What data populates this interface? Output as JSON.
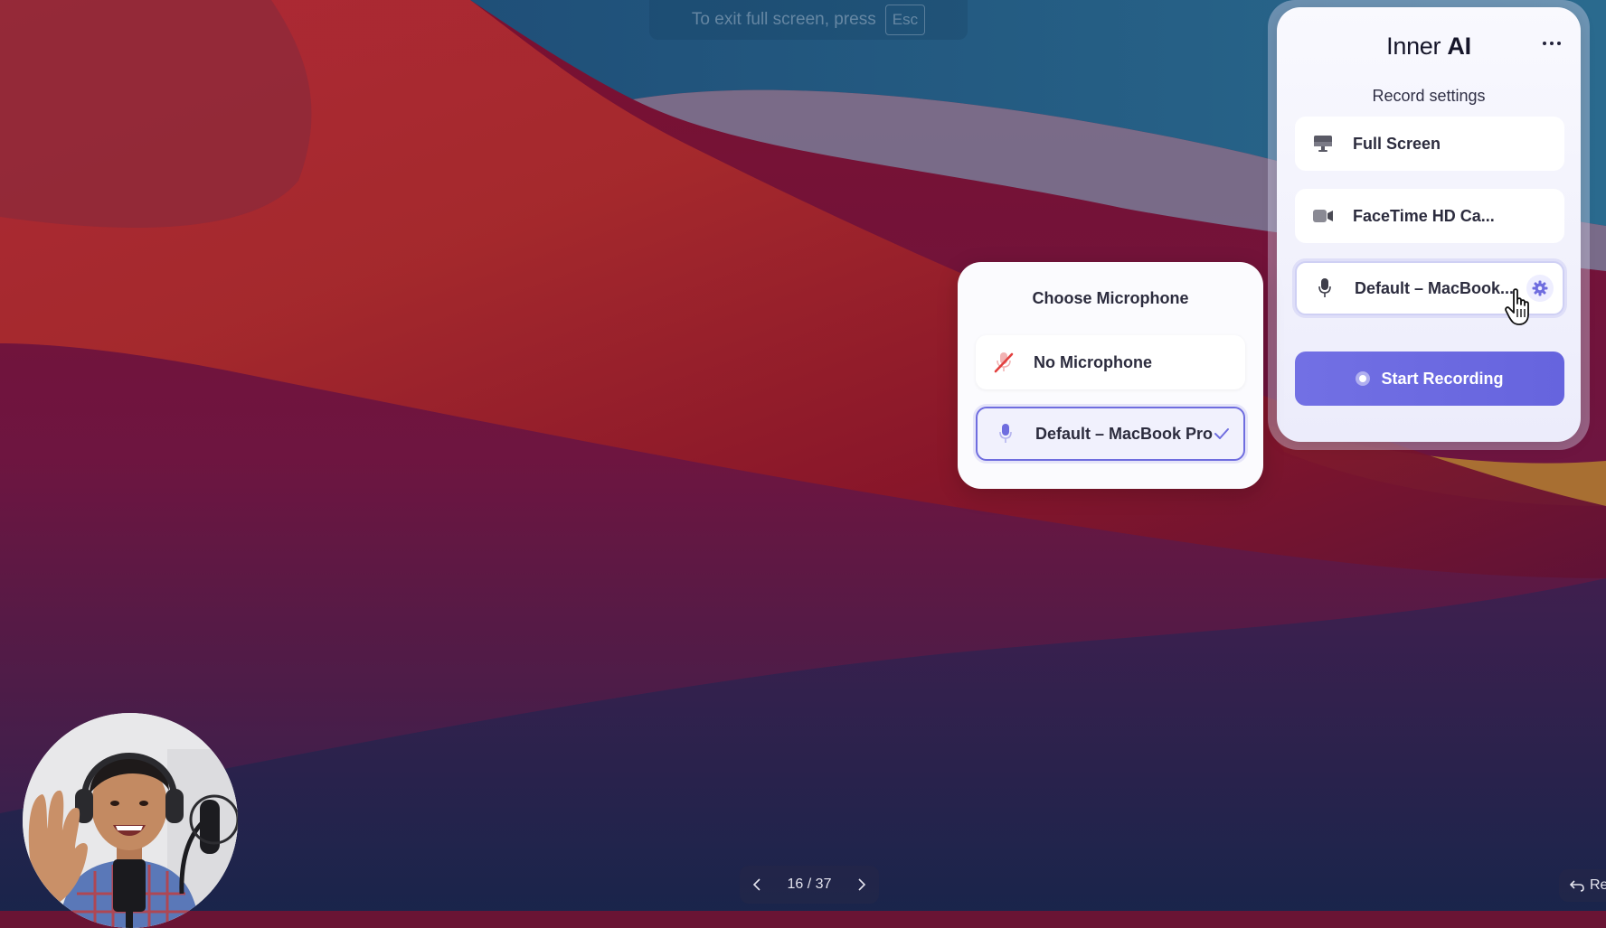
{
  "fullscreen_notice": {
    "text": "To exit full screen, press",
    "key": "Esc"
  },
  "panel": {
    "brand_light": "Inner ",
    "brand_bold": "AI",
    "more_icon": "ellipsis-icon",
    "subtitle": "Record settings",
    "options": [
      {
        "label": "Full Screen",
        "icon": "monitor-icon"
      },
      {
        "label": "FaceTime HD Ca...",
        "icon": "camera-icon"
      },
      {
        "label": "Default – MacBook...",
        "icon": "microphone-icon",
        "active": true,
        "action_icon": "gear-icon"
      }
    ],
    "start_label": "Start Recording"
  },
  "mic_popover": {
    "title": "Choose Microphone",
    "options": [
      {
        "label": "No Microphone",
        "icon": "microphone-off-icon",
        "selected": false
      },
      {
        "label": "Default – MacBook Pro",
        "icon": "microphone-icon",
        "selected": true
      }
    ]
  },
  "pager": {
    "text": "16 / 37"
  },
  "corner_button": {
    "label": "Re"
  },
  "colors": {
    "accent": "#6f6ddf",
    "danger": "#e2403f"
  }
}
